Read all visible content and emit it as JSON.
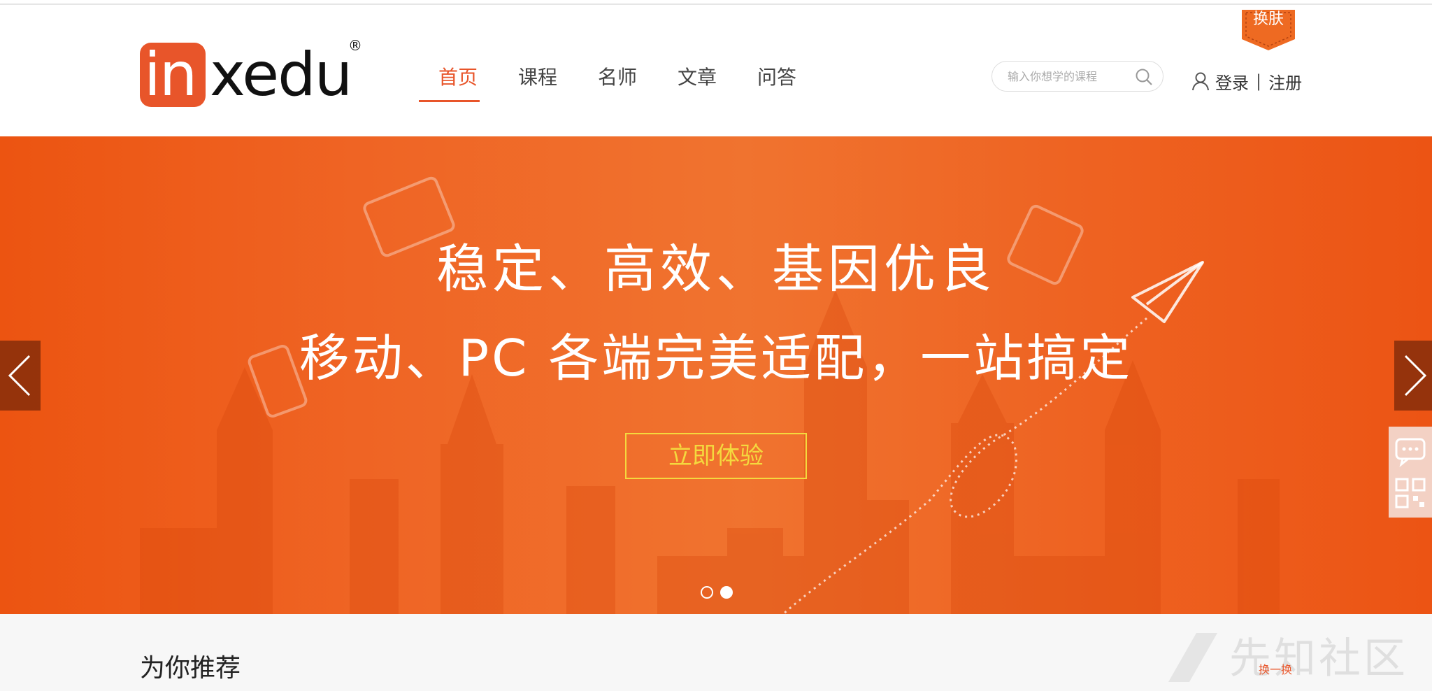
{
  "header": {
    "logo_in": "in",
    "logo_xedu": "xedu",
    "logo_reg": "®",
    "nav": [
      {
        "label": "首页",
        "active": true
      },
      {
        "label": "课程",
        "active": false
      },
      {
        "label": "名师",
        "active": false
      },
      {
        "label": "文章",
        "active": false
      },
      {
        "label": "问答",
        "active": false
      }
    ],
    "search_placeholder": "输入你想学的课程",
    "login_label": "登录",
    "separator": "|",
    "register_label": "注册",
    "skin_label": "换肤"
  },
  "banner": {
    "line1": "稳定、高效、基因优良",
    "line2": "移动、PC 各端完美适配，一站搞定",
    "cta_label": "立即体验",
    "slide_count": 2,
    "active_slide": 2
  },
  "recommend": {
    "title": "为你推荐",
    "refresh_label": "换一换"
  },
  "watermark": "先知社区",
  "colors": {
    "brand": "#e8552a",
    "banner": "#ef6424",
    "cta": "#f4d93e"
  }
}
